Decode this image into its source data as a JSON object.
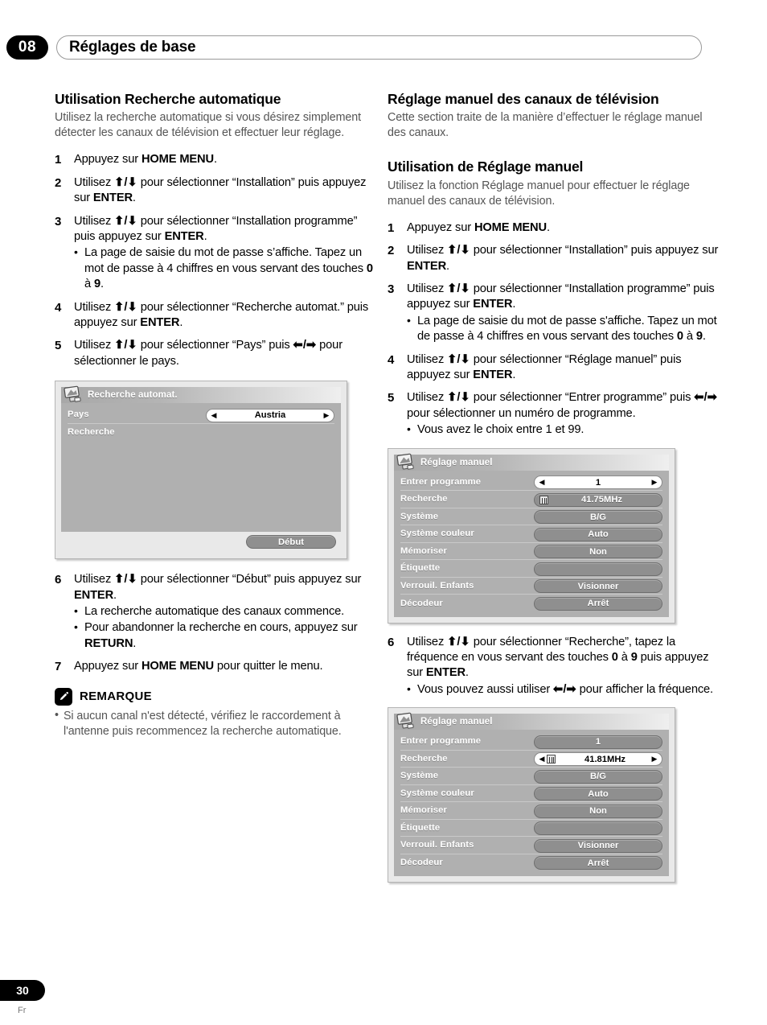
{
  "header": {
    "chapter_number": "08",
    "chapter_title": "Réglages de base"
  },
  "footer": {
    "page_number": "30",
    "language_code": "Fr"
  },
  "left_column": {
    "heading": "Utilisation Recherche automatique",
    "intro": "Utilisez la recherche automatique si vous désirez simplement détecter les canaux de télévision et effectuer leur réglage.",
    "steps": [
      {
        "num": "1",
        "text_html": "Appuyez sur <b>HOME MENU</b>."
      },
      {
        "num": "2",
        "text_html": "Utilisez <span class=\"arrowkeys\">&#10148;</span> pour sélectionner “Installation” puis appuyez sur <b>ENTER</b>."
      },
      {
        "num": "3",
        "text_html": "Utilisez <span class=\"arrowkeys\">&#10148;</span> pour sélectionner “Installation programme” puis appuyez sur <b>ENTER</b>.",
        "bullets_html": [
          "La page de saisie du mot de passe s’affiche. Tapez un mot de passe à 4 chiffres en vous servant des touches <b>0</b> à <b>9</b>."
        ]
      },
      {
        "num": "4",
        "text_html": "Utilisez <span class=\"arrowkeys\">&#10148;</span> pour sélectionner “Recherche automat.” puis appuyez sur <b>ENTER</b>."
      },
      {
        "num": "5",
        "text_html": "Utilisez <span class=\"arrowkeys\">&#10148;</span> pour sélectionner “Pays” puis <span class=\"arrowkeys\">&#10148;</span> pour sélectionner le pays."
      }
    ],
    "steps_after": [
      {
        "num": "6",
        "text_html": "Utilisez <span class=\"arrowkeys\">&#10148;</span> pour sélectionner “Début” puis appuyez sur <b>ENTER</b>.",
        "bullets_html": [
          "La recherche automatique des canaux commence.",
          "Pour abandonner la recherche en cours, appuyez sur <b>RETURN</b>."
        ]
      },
      {
        "num": "7",
        "text_html": "Appuyez sur <b>HOME MENU</b> pour quitter le menu."
      }
    ],
    "note": {
      "icon": "pencil-icon",
      "title": "REMARQUE",
      "items": [
        "Si aucun canal n'est détecté, vérifiez le raccordement à l'antenne puis recommencez la recherche automatique."
      ]
    }
  },
  "right_column": {
    "heading": "Réglage manuel des canaux de télévision",
    "intro": "Cette section traite de la manière d’effectuer le réglage manuel des canaux.",
    "subheading": "Utilisation de Réglage manuel",
    "sub_intro": "Utilisez la fonction Réglage manuel pour effectuer le réglage manuel des canaux de télévision.",
    "steps": [
      {
        "num": "1",
        "text_html": "Appuyez sur <b>HOME MENU</b>."
      },
      {
        "num": "2",
        "text_html": "Utilisez <span class=\"arrowkeys\">&#10148;</span> pour sélectionner “Installation” puis appuyez sur <b>ENTER</b>."
      },
      {
        "num": "3",
        "text_html": "Utilisez <span class=\"arrowkeys\">&#10148;</span> pour sélectionner “Installation programme” puis appuyez sur <b>ENTER</b>.",
        "bullets_html": [
          "La page de saisie du mot de passe s'affiche. Tapez un mot de passe à 4 chiffres en vous servant des touches <b>0</b> à <b>9</b>."
        ]
      },
      {
        "num": "4",
        "text_html": "Utilisez <span class=\"arrowkeys\">&#10148;</span> pour sélectionner “Réglage manuel” puis appuyez sur <b>ENTER</b>."
      },
      {
        "num": "5",
        "text_html": "Utilisez <span class=\"arrowkeys\">&#10148;</span> pour sélectionner “Entrer programme” puis <span class=\"arrowkeys\">&#10148;</span> pour sélectionner un numéro de programme.",
        "bullets_html": [
          "Vous avez le choix entre 1 et 99."
        ]
      }
    ],
    "steps_after": [
      {
        "num": "6",
        "text_html": "Utilisez <span class=\"arrowkeys\">&#10148;</span> pour sélectionner “Recherche”, tapez la fréquence en vous servant des touches <b>0</b> à <b>9</b> puis appuyez sur <b>ENTER</b>.",
        "bullets_html": [
          "Vous pouvez aussi utiliser <span class=\"arrowkeys\">&#10148;</span> pour afficher la fréquence."
        ]
      }
    ]
  },
  "osd_auto_search": {
    "icon": "tv-screen-icon",
    "title": "Recherche automat.",
    "rows": [
      {
        "label": "Pays",
        "value": "Austria",
        "state": "selected"
      },
      {
        "label": "Recherche",
        "value": "",
        "state": "empty"
      }
    ],
    "start_button": "Début"
  },
  "osd_manual_1": {
    "icon": "tv-screen-icon",
    "title": "Réglage manuel",
    "rows": [
      {
        "label": "Entrer programme",
        "value": "1",
        "state": "selected"
      },
      {
        "label": "Recherche",
        "value": "41.75MHz",
        "state": "dim",
        "icon": "tuner-icon"
      },
      {
        "label": "Système",
        "value": "B/G",
        "state": "dim"
      },
      {
        "label": "Système couleur",
        "value": "Auto",
        "state": "dim"
      },
      {
        "label": "Mémoriser",
        "value": "Non",
        "state": "dim"
      },
      {
        "label": "Étiquette",
        "value": "",
        "state": "dim"
      },
      {
        "label": "Verrouil. Enfants",
        "value": "Visionner",
        "state": "dim"
      },
      {
        "label": "Décodeur",
        "value": "Arrêt",
        "state": "dim"
      }
    ]
  },
  "osd_manual_2": {
    "icon": "tv-screen-icon",
    "title": "Réglage manuel",
    "rows": [
      {
        "label": "Entrer programme",
        "value": "1",
        "state": "dim"
      },
      {
        "label": "Recherche",
        "value": "41.81MHz",
        "state": "selected",
        "icon": "tuner-icon"
      },
      {
        "label": "Système",
        "value": "B/G",
        "state": "dim"
      },
      {
        "label": "Système couleur",
        "value": "Auto",
        "state": "dim"
      },
      {
        "label": "Mémoriser",
        "value": "Non",
        "state": "dim"
      },
      {
        "label": "Étiquette",
        "value": "",
        "state": "dim"
      },
      {
        "label": "Verrouil. Enfants",
        "value": "Visionner",
        "state": "dim"
      },
      {
        "label": "Décodeur",
        "value": "Arrêt",
        "state": "dim"
      }
    ]
  },
  "colors": {
    "ink": "#000000",
    "body_text": "#555555",
    "osd_frame": "#e9e9e9",
    "osd_body": "#b0b0b0",
    "osd_pill": "#8f8f8f",
    "osd_selected": "#ffffff"
  }
}
